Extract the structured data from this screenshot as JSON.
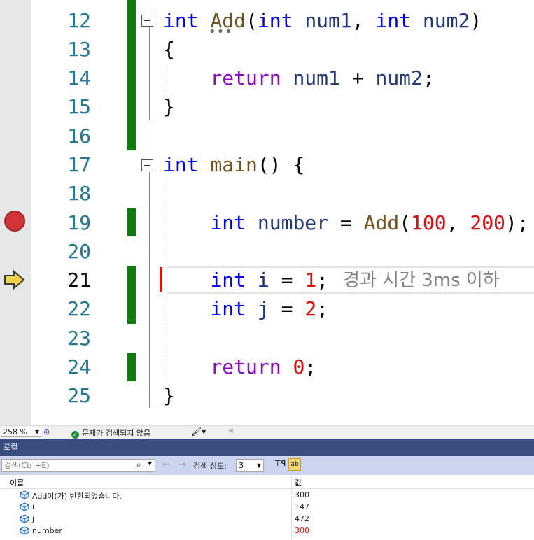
{
  "code": {
    "line_numbers": [
      "12",
      "13",
      "14",
      "15",
      "16",
      "17",
      "18",
      "19",
      "20",
      "21",
      "22",
      "23",
      "24",
      "25"
    ],
    "current_line": "21",
    "breakpoint_line": "19",
    "lines": {
      "l12": {
        "kw1": "int",
        "fn": "Add",
        "p1": "(",
        "kw2": "int",
        "pn1": "num1",
        ",": ", ",
        "kw3": "int",
        "pn2": "num2",
        "p2": ")"
      },
      "l13": {
        "brace": "{"
      },
      "l14": {
        "ret": "return",
        "pn1": "num1",
        "op": "+",
        "pn2": "num2",
        "semi": ";"
      },
      "l15": {
        "brace": "}"
      },
      "l17": {
        "kw": "int",
        "fn": "main",
        "rest": "() {"
      },
      "l19": {
        "kw": "int",
        "name": "number",
        "eq": "=",
        "fn": "Add",
        "p1": "(",
        "n1": "100",
        "comma": ",",
        "n2": "200",
        "p2": ");"
      },
      "l21": {
        "kw": "int",
        "name": "i",
        "eq": "=",
        "n": "1",
        "semi": ";"
      },
      "l22": {
        "kw": "int",
        "name": "j",
        "eq": "=",
        "n": "2",
        "semi": ";"
      },
      "l24": {
        "ret": "return",
        "n": "0",
        "semi": ";"
      },
      "l25": {
        "brace": "}"
      }
    },
    "perf_tip": "경과 시간 3ms 이하"
  },
  "statusbar": {
    "zoom": "258 %",
    "issues": "문제가 검색되지 않음"
  },
  "locals": {
    "title": "로컬",
    "search_placeholder": "검색(Ctrl+E)",
    "depth_label": "검색 심도:",
    "depth_value": "3",
    "hex_label": "ab",
    "columns": {
      "name": "이름",
      "value": "값"
    },
    "rows": [
      {
        "name": "Add이(가) 반환되었습니다.",
        "value": "300",
        "changed": false
      },
      {
        "name": "i",
        "value": "147",
        "changed": false
      },
      {
        "name": "j",
        "value": "472",
        "changed": false
      },
      {
        "name": "number",
        "value": "300",
        "changed": true
      }
    ]
  },
  "colors": {
    "keyword": "#0000ff",
    "return_keyword": "#8f08c4",
    "function": "#74531f",
    "parameter": "#1f377f",
    "number_literal": "#e30b0b",
    "line_number": "#237893",
    "change_bar": "#107c10",
    "breakpoint": "#d13438",
    "panel_title_bg": "#394e7e",
    "changed_value": "#e51400"
  },
  "icons": {
    "breakpoint": "breakpoint-icon",
    "current_statement": "current-statement-arrow-icon",
    "variable": "variable-icon",
    "issues_ok": "check-circle-icon",
    "search": "search-icon",
    "brush": "brush-icon"
  }
}
